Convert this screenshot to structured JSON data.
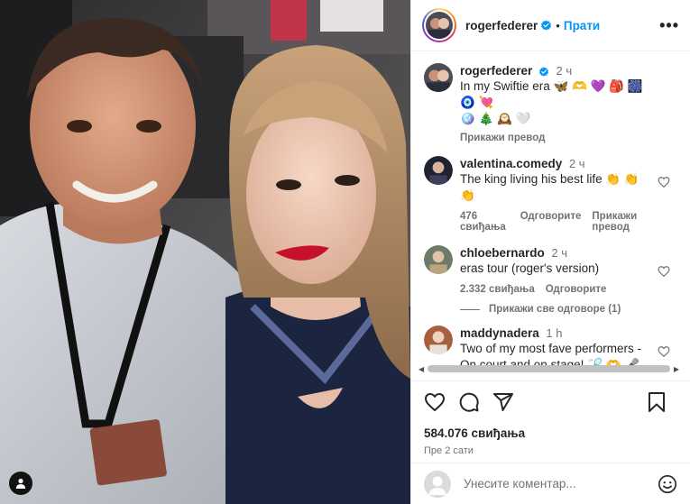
{
  "post": {
    "author": "rogerfederer",
    "follow_label": "Прати",
    "more_label": "•••",
    "caption": {
      "username": "rogerfederer",
      "time": "2 ч",
      "text": "In my Swiftie era 🦋 🫶 💜 🎒 🎆 🧿 💘",
      "text2": "🪩 🎄 🕰️ 🤍",
      "translate_label": "Прикажи превод"
    },
    "comments": [
      {
        "username": "valentina.comedy",
        "time": "2 ч",
        "text": "The king living his best life 👏 👏 👏",
        "likes": "476 свиђања",
        "reply_label": "Одговорите",
        "translate_label": "Прикажи превод"
      },
      {
        "username": "chloebernardo",
        "time": "2 ч",
        "text": "eras tour (roger's version)",
        "likes": "2.332 свиђања",
        "reply_label": "Одговорите",
        "view_replies_label": "Прикажи све одговоре (1)"
      },
      {
        "username": "maddynadera",
        "time": "1 h",
        "text": "Two of my most fave performers - On court and on stage! 🏸 🫶 🎤 💝"
      }
    ],
    "likes_total": "584.076 свиђања",
    "posted_time": "Пре 2 сати",
    "comment_placeholder": "Унесите коментар..."
  },
  "icons": {
    "verified": "verified-badge-icon",
    "like": "heart-icon",
    "comment": "comment-icon",
    "share": "share-icon",
    "save": "bookmark-icon",
    "emoji": "emoji-icon",
    "user_tag": "user-icon"
  },
  "colors": {
    "accent": "#0095f6",
    "muted": "#737373",
    "text": "#262626",
    "border": "#efefef"
  }
}
